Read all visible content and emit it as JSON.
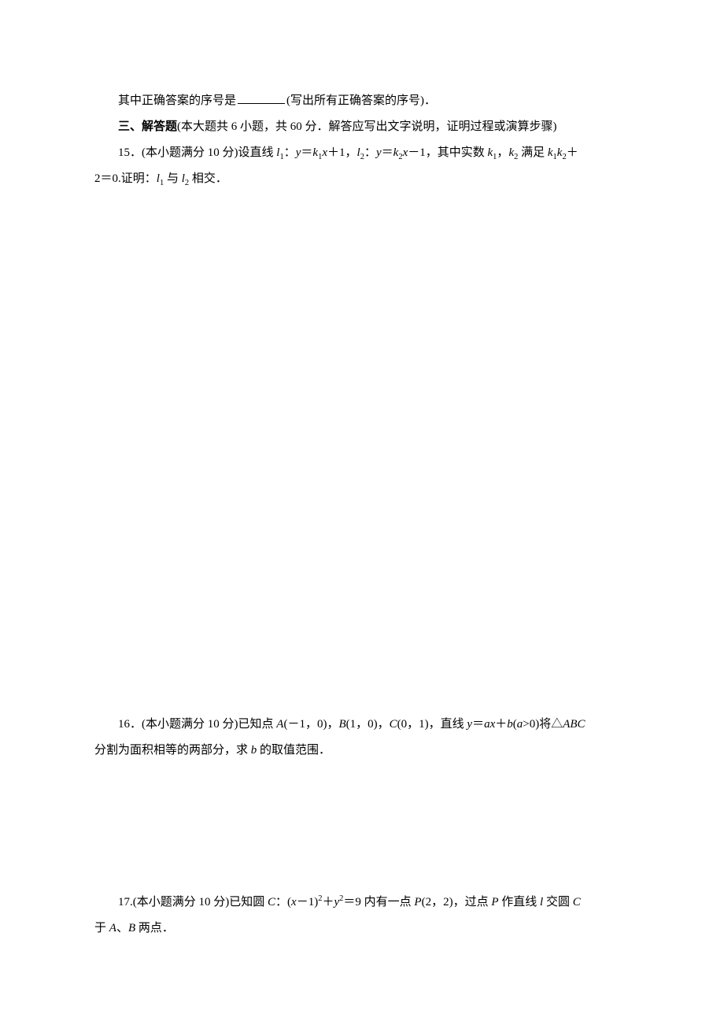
{
  "answer_hint": {
    "prefix": "其中正确答案的序号是",
    "suffix": "(写出所有正确答案的序号)．"
  },
  "section3": {
    "label": "三、解答题",
    "desc": "(本大题共 6 小题，共 60 分．解答应写出文字说明，证明过程或演算步骤)"
  },
  "q15": {
    "num": "15．",
    "points_prefix": "(本小题满分 10 分)",
    "t1": "设直线 ",
    "l1": "l",
    "l1sub": "1",
    "l1colon": "：",
    "eq1a": "y",
    "eq1b": "＝",
    "eq1c": "k",
    "eq1csub": "1",
    "eq1d": "x",
    "eq1e": "＋1，",
    "l2": "l",
    "l2sub": "2",
    "l2colon": "：",
    "eq2a": "y",
    "eq2b": "＝",
    "eq2c": "k",
    "eq2csub": "2",
    "eq2d": "x",
    "eq2e": "－1，其中实数 ",
    "k1": "k",
    "k1sub": "1",
    "comma": "，",
    "k2": "k",
    "k2sub": "2",
    "sat": " 满足 ",
    "kk1": "k",
    "kk1sub": "1",
    "kk2": "k",
    "kk2sub": "2",
    "plus": "＋",
    "line2a": "2＝0.证明：",
    "ll1": "l",
    "ll1sub": "1",
    "and": " 与 ",
    "ll2": "l",
    "ll2sub": "2",
    "intersect": " 相交．"
  },
  "q16": {
    "num": "16．",
    "points_prefix": "(本小题满分 10 分)",
    "t1": "已知点 ",
    "A": "A",
    "Apt": "(－1，0)，",
    "B": "B",
    "Bpt": "(1，0)，",
    "C": "C",
    "Cpt": "(0，1)，直线 ",
    "y": "y",
    "eq": "＝",
    "a": "a",
    "x": "x",
    "plus": "＋",
    "b": "b",
    "cond": "(",
    "a2": "a",
    "gt": ">0)将△",
    "ABC": "ABC",
    "line2": "分割为面积相等的两部分，求 ",
    "b2": "b",
    "line2b": " 的取值范围．"
  },
  "q17": {
    "num": "17.",
    "points_prefix": "(本小题满分 10 分)",
    "t1": "已知圆 ",
    "C": "C",
    "colon": "：(",
    "x": "x",
    "minus": "－1)",
    "sq": "2",
    "plus": "＋",
    "y": "y",
    "sq2": "2",
    "eq": "＝9 内有一点 ",
    "P": "P",
    "Ppt": "(2，2)，过点 ",
    "P2": "P",
    "t2": " 作直线 ",
    "l": "l",
    "t3": " 交圆 ",
    "C2": "C",
    "line2a": "于 ",
    "A": "A",
    "sep": "、",
    "B": "B",
    "line2b": " 两点．"
  }
}
